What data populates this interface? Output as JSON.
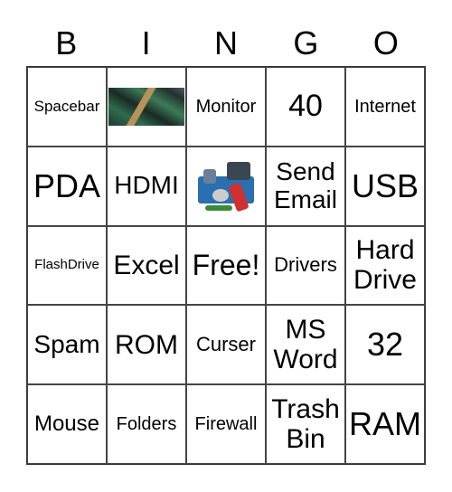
{
  "header": [
    "B",
    "I",
    "N",
    "G",
    "O"
  ],
  "cells": [
    [
      "Spacebar",
      {
        "image": "computer-chips-image"
      },
      "Monitor",
      "40",
      "Internet"
    ],
    [
      "PDA",
      "HDMI",
      {
        "image": "computer-hardware-image"
      },
      "Send Email",
      "USB"
    ],
    [
      "FlashDrive",
      "Excel",
      "Free!",
      "Drivers",
      "Hard Drive"
    ],
    [
      "Spam",
      "ROM",
      "Curser",
      "MS Word",
      "32"
    ],
    [
      "Mouse",
      "Folders",
      "Firewall",
      "Trash Bin",
      "RAM"
    ]
  ]
}
